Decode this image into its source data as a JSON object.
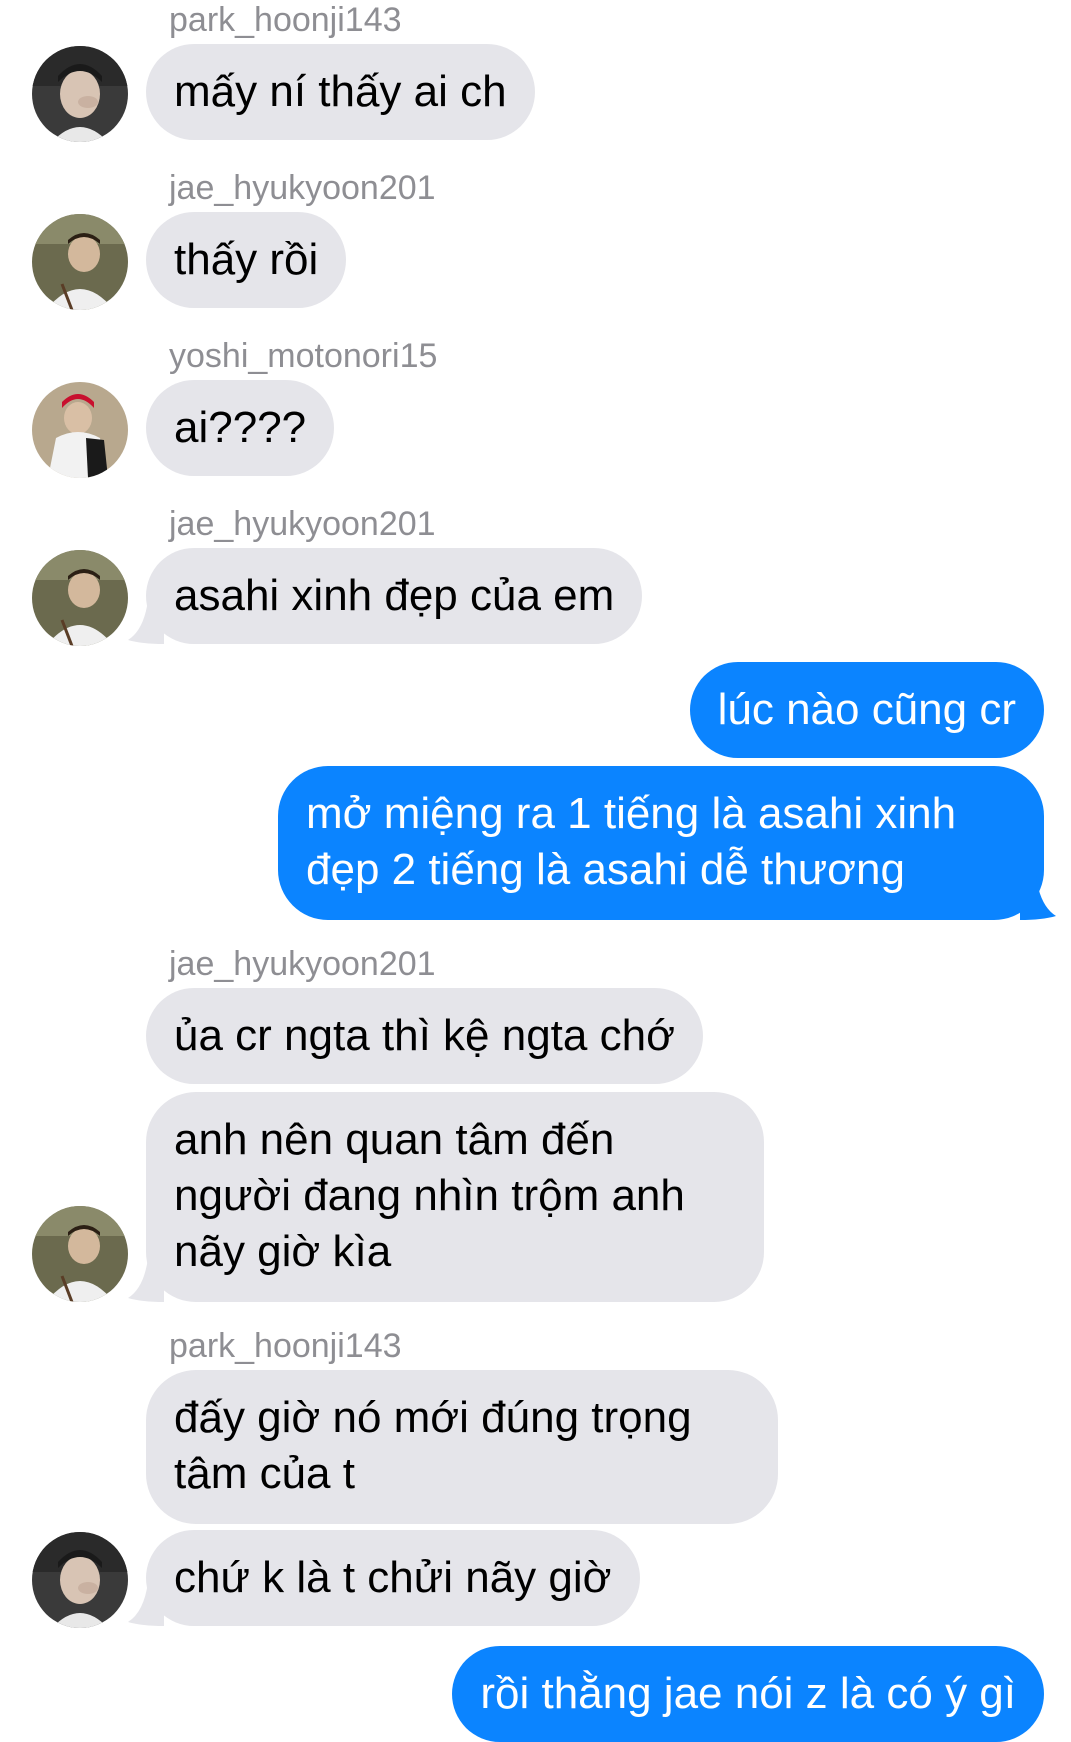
{
  "colors": {
    "incoming_bubble": "#e5e5ea",
    "outgoing_bubble": "#0b84ff",
    "sender_name": "#8e8e93"
  },
  "messages": [
    {
      "sender": "park_hoonji143",
      "text": "mấy ní thấy ai ch",
      "direction": "incoming",
      "avatar": "avatar-park-hoonji"
    },
    {
      "sender": "jae_hyukyoon201",
      "text": "thấy rồi",
      "direction": "incoming",
      "avatar": "avatar-jae-hyukyoon"
    },
    {
      "sender": "yoshi_motonori15",
      "text": "ai????",
      "direction": "incoming",
      "avatar": "avatar-yoshi-motonori"
    },
    {
      "sender": "jae_hyukyoon201",
      "text": "asahi xinh đẹp của em",
      "direction": "incoming",
      "avatar": "avatar-jae-hyukyoon"
    },
    {
      "text": "lúc nào cũng cr",
      "direction": "outgoing"
    },
    {
      "text_lines": [
        "mở miệng ra 1 tiếng là asahi xinh",
        "đẹp 2 tiếng là asahi dễ thương"
      ],
      "direction": "outgoing"
    },
    {
      "sender": "jae_hyukyoon201",
      "text": "ủa cr ngta thì kệ ngta chớ",
      "direction": "incoming"
    },
    {
      "text_lines": [
        "anh nên quan tâm đến",
        "người đang nhìn trộm anh",
        "nãy giờ kìa"
      ],
      "direction": "incoming",
      "avatar": "avatar-jae-hyukyoon"
    },
    {
      "sender": "park_hoonji143",
      "text_lines": [
        "đấy giờ nó mới đúng trọng",
        "tâm của t"
      ],
      "direction": "incoming"
    },
    {
      "text": "chứ k là t chửi nãy giờ",
      "direction": "incoming",
      "avatar": "avatar-park-hoonji"
    },
    {
      "text": "rồi thằng jae nói z là có ý gì",
      "direction": "outgoing"
    }
  ]
}
